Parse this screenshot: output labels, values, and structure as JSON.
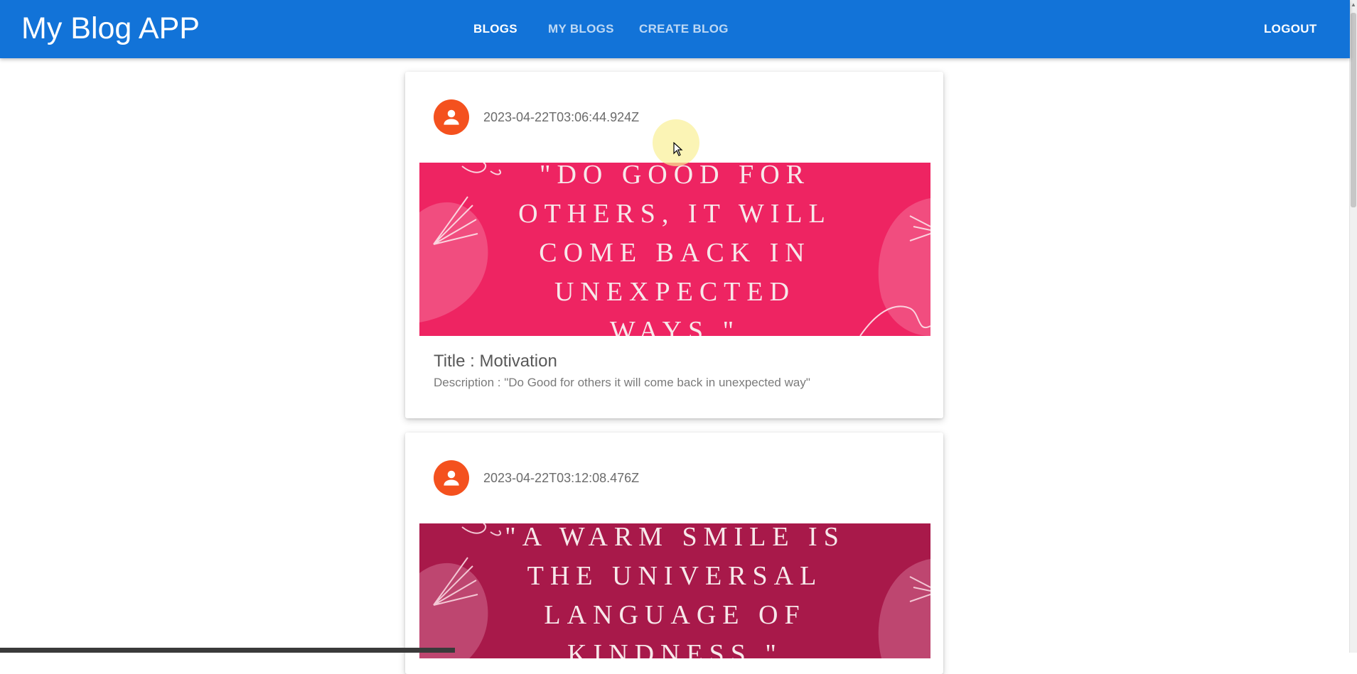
{
  "app": {
    "title": "My Blog APP"
  },
  "nav": {
    "blogs": "BLOGS",
    "my_blogs": "MY BLOGS",
    "create_blog": "CREATE BLOG",
    "logout": "LOGOUT"
  },
  "colors": {
    "appbar": "#1273d8",
    "avatar": "#f4511e",
    "card1_media": "#ee2462",
    "card2_media": "#a8194a"
  },
  "posts": [
    {
      "avatar_icon": "person-icon",
      "date": "2023-04-22T03:06:44.924Z",
      "image_quote": "\"DO GOOD FOR\nOTHERS, IT WILL\nCOME BACK IN\nUNEXPECTED\nWAYS.\"",
      "title": "Title : Motivation",
      "description": "Description : \"Do Good for others it will come back in unexpected way\""
    },
    {
      "avatar_icon": "person-icon",
      "date": "2023-04-22T03:12:08.476Z",
      "image_quote": "\"A WARM SMILE IS\nTHE UNIVERSAL\nLANGUAGE OF\nKINDNESS.\""
    }
  ]
}
